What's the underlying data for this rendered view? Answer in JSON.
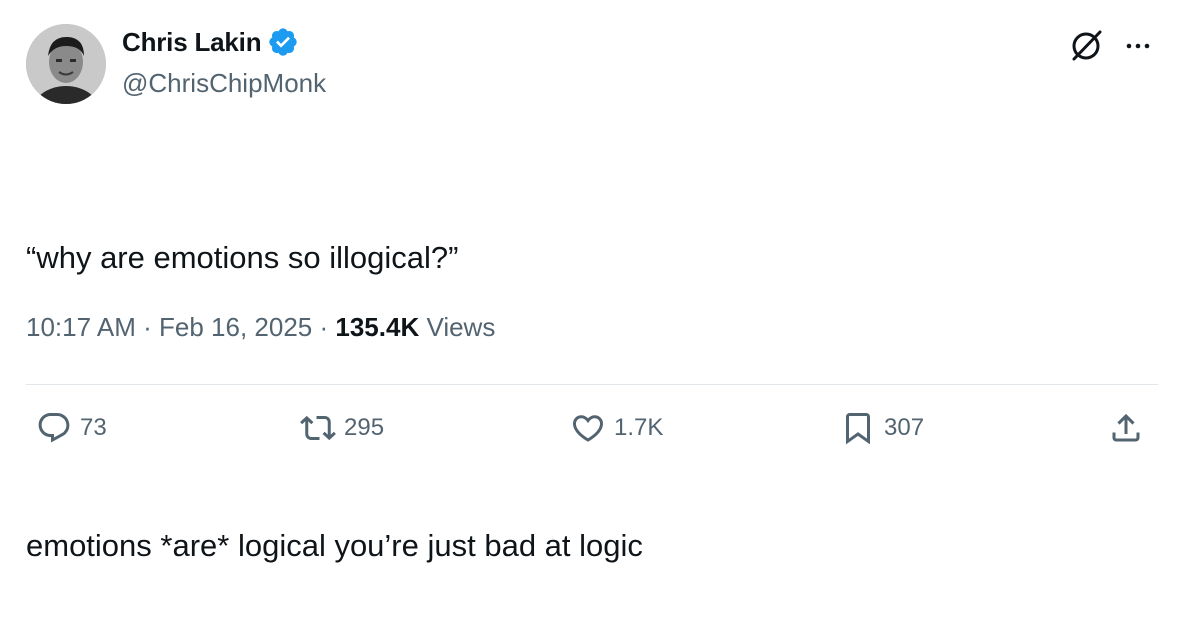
{
  "author": {
    "name": "Chris Lakin",
    "handle": "@ChrisChipMonk",
    "verified": true
  },
  "tweet": {
    "lines": [
      "“why are emotions so illogical?”",
      "",
      "emotions *are* logical you’re just bad at logic"
    ],
    "time": "10:17 AM",
    "date": "Feb 16, 2025",
    "separator": "·",
    "views_count": "135.4K",
    "views_label": "Views"
  },
  "actions": {
    "replies": "73",
    "retweets": "295",
    "likes": "1.7K",
    "bookmarks": "307"
  },
  "colors": {
    "verified": "#1d9bf0",
    "text": "#0f1419",
    "muted": "#536471",
    "divider": "#e1e6ea"
  },
  "icons": [
    "grok-icon",
    "more-icon",
    "reply-icon",
    "retweet-icon",
    "like-icon",
    "bookmark-icon",
    "share-icon",
    "verified-badge-icon"
  ]
}
